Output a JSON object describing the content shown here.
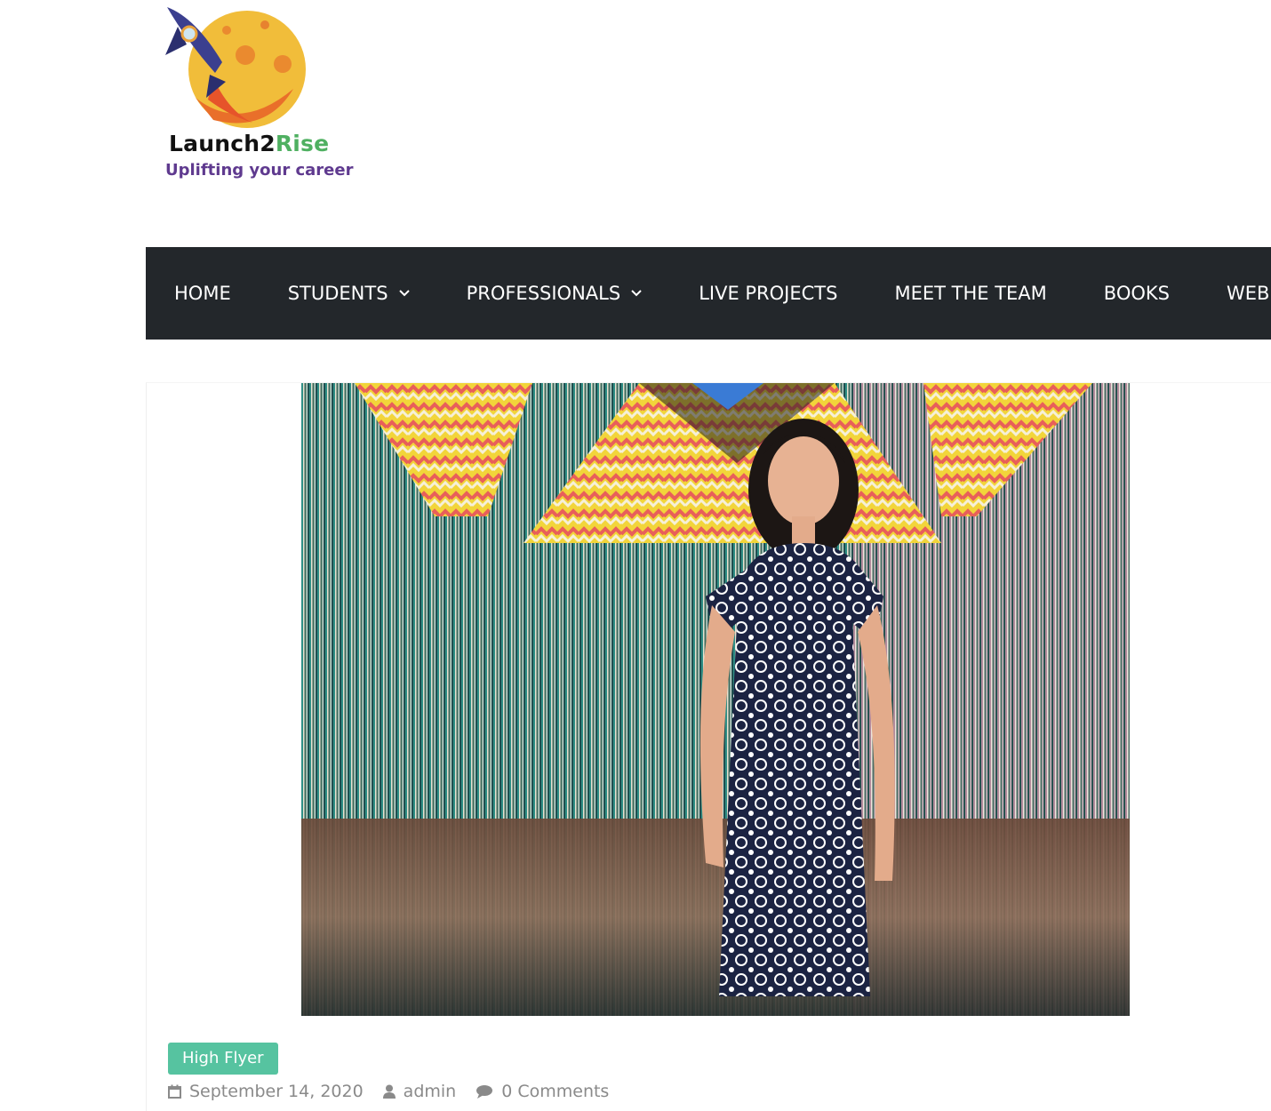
{
  "site": {
    "name_part1": "Launch2",
    "name_part2": "Rise",
    "tagline": "Uplifting  your career",
    "logo_icon": "rocket-moon-logo",
    "colors": {
      "name_dark": "#111111",
      "name_accent": "#4fb061",
      "tagline": "#5f3a8f"
    }
  },
  "nav": {
    "background": "#23272b",
    "items": [
      {
        "label": "HOME",
        "has_dropdown": false
      },
      {
        "label": "STUDENTS",
        "has_dropdown": true
      },
      {
        "label": "PROFESSIONALS",
        "has_dropdown": true
      },
      {
        "label": "LIVE PROJECTS",
        "has_dropdown": false
      },
      {
        "label": "MEET THE TEAM",
        "has_dropdown": false
      },
      {
        "label": "BOOKS",
        "has_dropdown": false
      },
      {
        "label": "WEBI",
        "has_dropdown": false
      }
    ]
  },
  "article": {
    "category": "High Flyer",
    "category_color": "#56c3a0",
    "date": "September 14, 2020",
    "author": "admin",
    "comments": "0 Comments",
    "icons": {
      "date": "calendar-icon",
      "author": "user-icon",
      "comments": "comment-icon"
    }
  }
}
